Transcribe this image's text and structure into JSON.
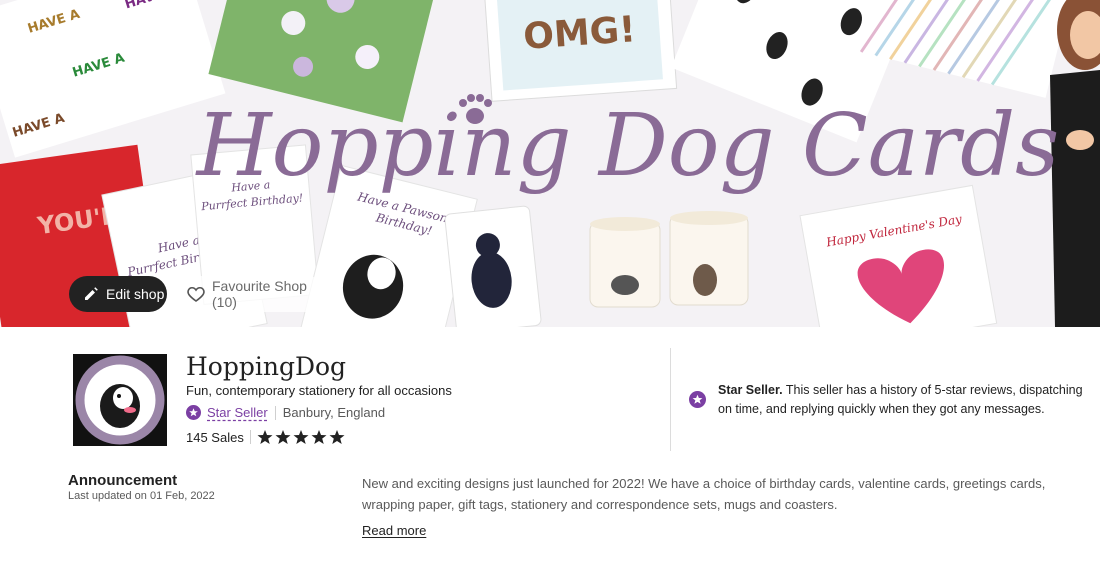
{
  "banner": {
    "title": "Hopping Dog Cards",
    "edit_label": "Edit shop",
    "favourite_label": "Favourite Shop (10)",
    "card_texts": {
      "marvellous": "HAVE A MARVELLOUS BIRTHDAY!",
      "omg": "OMG!",
      "youre": "YOU'RE",
      "purrfect": "Have a Purrfect Birthday!",
      "pawsome": "Have a Pawsome Birthday!",
      "valentines": "Happy Valentine's Day"
    }
  },
  "shop": {
    "name": "HoppingDog",
    "tagline": "Fun, contemporary stationery for all occasions",
    "star_seller_label": "Star Seller",
    "location": "Banbury, England",
    "sales": "145 Sales",
    "rating": 5,
    "logo_text": "Hopping Dog Cards",
    "logo_url": "www.hoppingdogcards.com",
    "star_info_bold": "Star Seller.",
    "star_info_text": " This seller has a history of 5-star reviews, dispatching on time, and replying quickly when they got any messages."
  },
  "announcement": {
    "title": "Announcement",
    "updated": "Last updated on 01 Feb, 2022",
    "body": "New and exciting designs just launched for 2022! We have a choice of birthday cards, valentine cards, greetings cards, wrapping paper, gift tags, stationery and correspondence sets, mugs and coasters.",
    "read_more": "Read more"
  },
  "colors": {
    "accent_purple": "#7b3fa3",
    "title_purple": "#8a6b96",
    "button_dark": "#222222"
  }
}
